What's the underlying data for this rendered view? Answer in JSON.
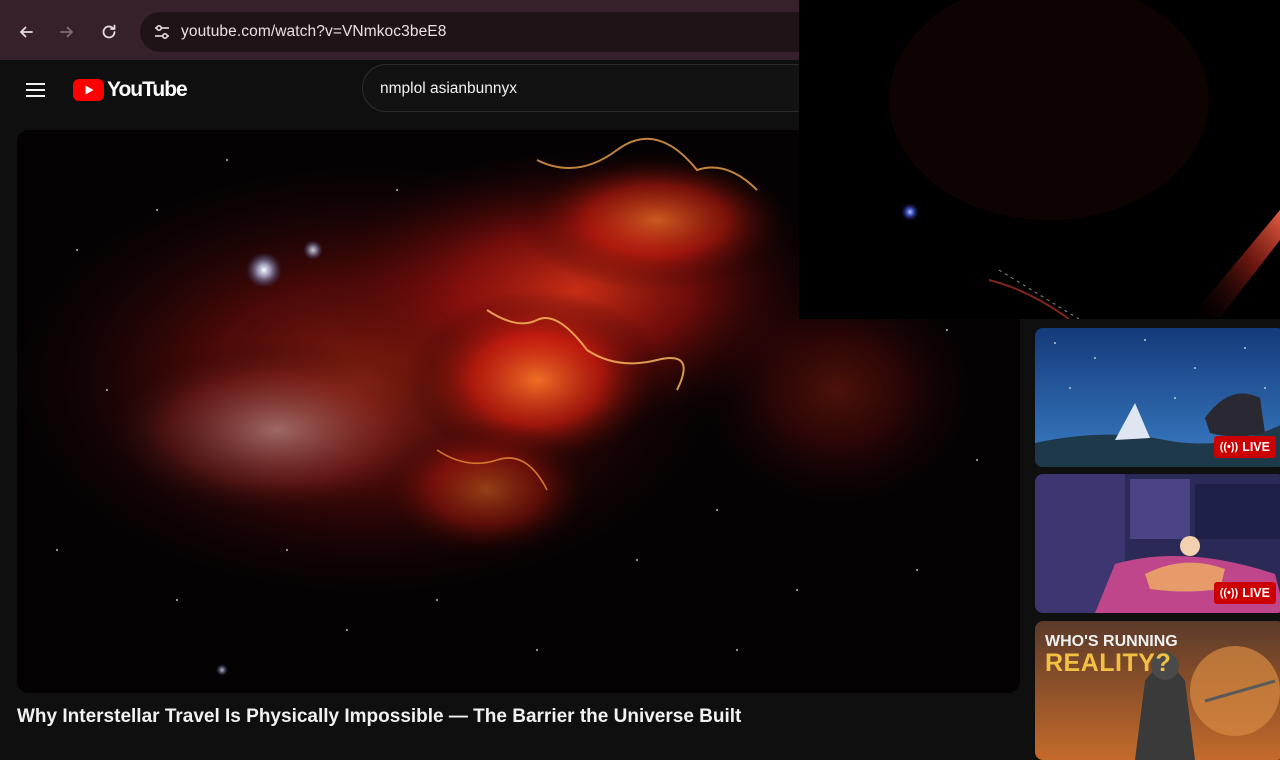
{
  "browser": {
    "url": "youtube.com/watch?v=VNmkoc3beE8"
  },
  "youtube": {
    "logo_text": "YouTube",
    "search": {
      "value": "nmplol asianbunnyx"
    }
  },
  "video": {
    "title": "Why Interstellar Travel Is Physically Impossible — The Barrier the Universe Built"
  },
  "sidebar": {
    "thumbnails": [
      {
        "badge": "LIVE"
      },
      {
        "badge": "LIVE"
      },
      {
        "line1": "WHO'S RUNNING",
        "line2": "REALITY?"
      }
    ]
  },
  "colors": {
    "browser_bar": "#35202c",
    "yt_red": "#ff0000",
    "live_red": "#cc0000",
    "page_bg": "#0f0f0f"
  }
}
